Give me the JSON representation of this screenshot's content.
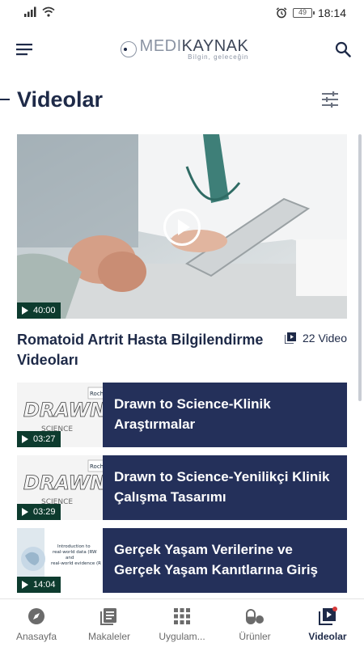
{
  "status": {
    "time": "18:14",
    "battery": "49"
  },
  "header": {
    "logo_medi": "MEDI",
    "logo_kaynak": "KAYNAK",
    "logo_tagline": "Bilgin, geleceğin"
  },
  "page": {
    "title": "Videolar"
  },
  "featured": {
    "duration": "40:00",
    "title": "Romatoid Artrit Hasta Bilgilendirme Videoları",
    "video_count": "22 Video"
  },
  "videos": [
    {
      "title": "Drawn to Science-Klinik Araştırmalar",
      "duration": "03:27",
      "thumb_text": "DRAWN",
      "thumb_sub": "SCIENCE",
      "thumb_brand": "Roch"
    },
    {
      "title": "Drawn to Science-Yenilikçi Klinik Çalışma Tasarımı",
      "duration": "03:29",
      "thumb_text": "DRAWN",
      "thumb_sub": "SCIENCE",
      "thumb_brand": "Roch"
    },
    {
      "title": "Gerçek Yaşam Verilerine ve Gerçek Yaşam Kanıtlarına Giriş",
      "duration": "14:04",
      "thumb_line1": "Introduction to",
      "thumb_line2": "real-world data (RW",
      "thumb_line3": "and",
      "thumb_line4": "real-world evidence (R"
    }
  ],
  "nav": [
    {
      "label": "Anasayfa",
      "icon": "compass-icon"
    },
    {
      "label": "Makaleler",
      "icon": "article-icon"
    },
    {
      "label": "Uygulam...",
      "icon": "apps-grid-icon"
    },
    {
      "label": "Ürünler",
      "icon": "pill-icon"
    },
    {
      "label": "Videolar",
      "icon": "video-icon",
      "active": true
    }
  ],
  "colors": {
    "primary": "#1e2a48",
    "card": "#24305a",
    "duration_bg": "#0d3b2e",
    "badge": "#d63a3a"
  }
}
